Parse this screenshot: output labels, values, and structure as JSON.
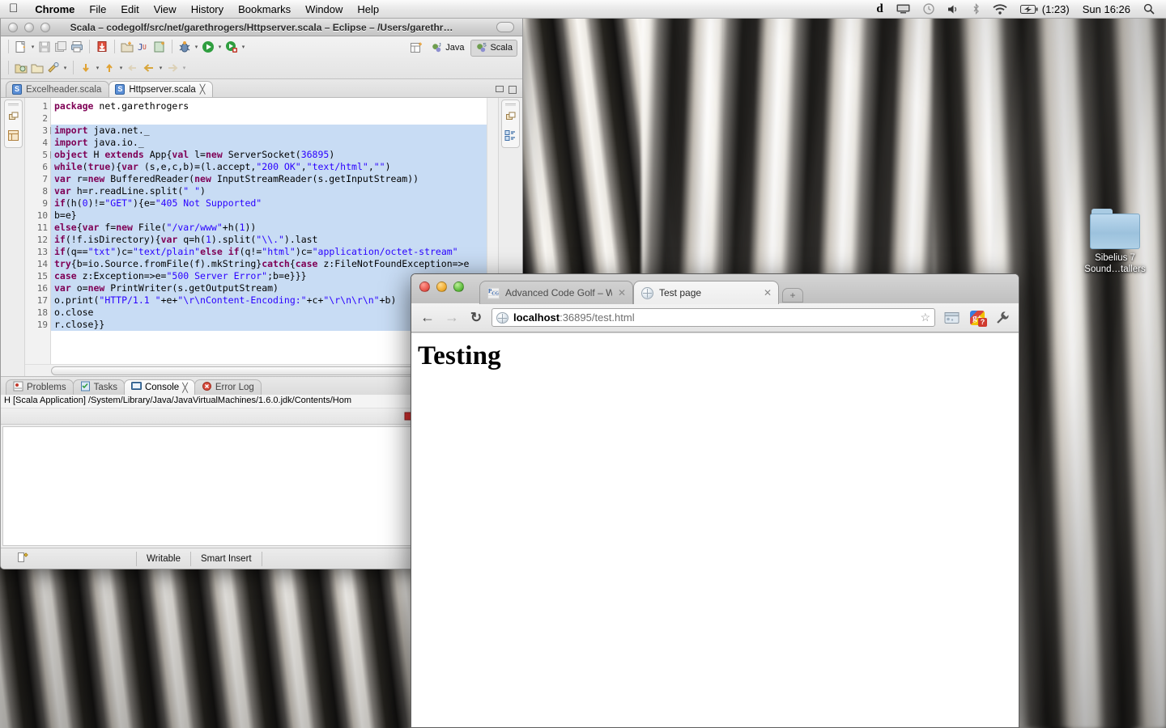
{
  "menubar": {
    "apple_icon": "apple-logo-icon",
    "items": [
      "Chrome",
      "File",
      "Edit",
      "View",
      "History",
      "Bookmarks",
      "Window",
      "Help"
    ],
    "status": {
      "dropbox_label": "d",
      "display_icon": "display-icon",
      "clock_icon": "clock-icon",
      "volume_icon": "volume-icon",
      "bluetooth_icon": "bluetooth-icon",
      "wifi_icon": "wifi-icon",
      "battery_icon": "battery-icon",
      "battery_time": "(1:23)",
      "datetime": "Sun 16:26",
      "search_icon": "spotlight-search-icon"
    }
  },
  "eclipse": {
    "window_title": "Scala – codegolf/src/net/garethrogers/Httpserver.scala – Eclipse – /Users/garethr…",
    "perspectives": [
      {
        "label": "Java",
        "active": false
      },
      {
        "label": "Scala",
        "active": true
      }
    ],
    "editor_tabs": [
      {
        "label": "Excelheader.scala",
        "active": false,
        "dirty": false
      },
      {
        "label": "Httpserver.scala",
        "active": true,
        "dirty": false
      }
    ],
    "code": {
      "lines": [
        {
          "n": "1",
          "fold": false,
          "selected": false,
          "text": "package net.garethrogers"
        },
        {
          "n": "2",
          "fold": false,
          "selected": false,
          "text": ""
        },
        {
          "n": "3",
          "fold": true,
          "selected": true,
          "text": "import java.net._"
        },
        {
          "n": "4",
          "fold": false,
          "selected": true,
          "text": "import java.io._"
        },
        {
          "n": "5",
          "fold": true,
          "selected": true,
          "text": "object H extends App{val l=new ServerSocket(36895)"
        },
        {
          "n": "6",
          "fold": false,
          "selected": true,
          "text": "while(true){var (s,e,c,b)=(l.accept,\"200 OK\",\"text/html\",\"\")"
        },
        {
          "n": "7",
          "fold": false,
          "selected": true,
          "text": "var r=new BufferedReader(new InputStreamReader(s.getInputStream))"
        },
        {
          "n": "8",
          "fold": false,
          "selected": true,
          "text": "var h=r.readLine.split(\" \")"
        },
        {
          "n": "9",
          "fold": false,
          "selected": true,
          "text": "if(h(0)!=\"GET\"){e=\"405 Not Supported\""
        },
        {
          "n": "10",
          "fold": false,
          "selected": true,
          "text": "b=e}"
        },
        {
          "n": "11",
          "fold": false,
          "selected": true,
          "text": "else{var f=new File(\"/var/www\"+h(1))"
        },
        {
          "n": "12",
          "fold": false,
          "selected": true,
          "text": "if(!f.isDirectory){var q=h(1).split(\"\\\\.\").last"
        },
        {
          "n": "13",
          "fold": false,
          "selected": true,
          "text": "if(q==\"txt\")c=\"text/plain\"else if(q!=\"html\")c=\"application/octet-stream\""
        },
        {
          "n": "14",
          "fold": false,
          "selected": true,
          "text": "try{b=io.Source.fromFile(f).mkString}catch{case z:FileNotFoundException=>e"
        },
        {
          "n": "15",
          "fold": false,
          "selected": true,
          "text": "case z:Exception=>e=\"500 Server Error\";b=e}}}"
        },
        {
          "n": "16",
          "fold": false,
          "selected": true,
          "text": "var o=new PrintWriter(s.getOutputStream)"
        },
        {
          "n": "17",
          "fold": false,
          "selected": true,
          "text": "o.print(\"HTTP/1.1 \"+e+\"\\r\\nContent-Encoding:\"+c+\"\\r\\n\\r\\n\"+b)"
        },
        {
          "n": "18",
          "fold": false,
          "selected": true,
          "text": "o.close"
        },
        {
          "n": "19",
          "fold": false,
          "selected": true,
          "text": "r.close}}"
        }
      ]
    },
    "bottom_views": {
      "tabs": [
        {
          "label": "Problems",
          "icon": "problems-icon",
          "active": false
        },
        {
          "label": "Tasks",
          "icon": "tasks-icon",
          "active": false
        },
        {
          "label": "Console",
          "icon": "console-icon",
          "active": true
        },
        {
          "label": "Error Log",
          "icon": "error-log-icon",
          "active": false
        }
      ],
      "console_title": "H [Scala Application] /System/Library/Java/JavaVirtualMachines/1.6.0.jdk/Contents/Hom",
      "console_output": "",
      "toolbar_icons": [
        "terminate-icon",
        "remove-launch-icon",
        "remove-all-terminated-icon",
        "clear-console-icon",
        "scroll-lock-icon",
        "display-selected-console-icon"
      ]
    },
    "statusbar": {
      "writable": "Writable",
      "insert_mode": "Smart Insert"
    }
  },
  "desktop": {
    "folder_icon": {
      "name": "folder-icon",
      "label_line1": "Sibelius 7",
      "label_line2": "Sound…tallers"
    }
  },
  "chrome": {
    "tabs": [
      {
        "title": "Advanced Code Golf – Write",
        "favicon": "pcg-favicon",
        "active": false,
        "close_label": "✕"
      },
      {
        "title": "Test page",
        "favicon": "globe-favicon",
        "active": true,
        "close_label": "✕"
      }
    ],
    "new_tab_label": "+",
    "toolbar": {
      "back_icon": "back-arrow-icon",
      "forward_icon": "forward-arrow-icon",
      "reload_icon": "reload-icon",
      "site_icon": "globe-icon",
      "url_host": "localhost",
      "url_rest": ":36895/test.html",
      "bookmark_icon": "star-icon",
      "extension1_icon": "window-extension-icon",
      "gplus_icon": "google-plus-extension-icon",
      "gplus_label": "g+",
      "gplus_badge": "?",
      "menu_icon": "wrench-menu-icon"
    },
    "page": {
      "heading": "Testing"
    }
  },
  "colors": {
    "selection_blue": "#c8dcf4",
    "keyword_purple": "#7f0055",
    "string_blue": "#2a00ff",
    "chrome_badge_red": "#d03a2e",
    "folder_blue": "#9cc2dd"
  }
}
